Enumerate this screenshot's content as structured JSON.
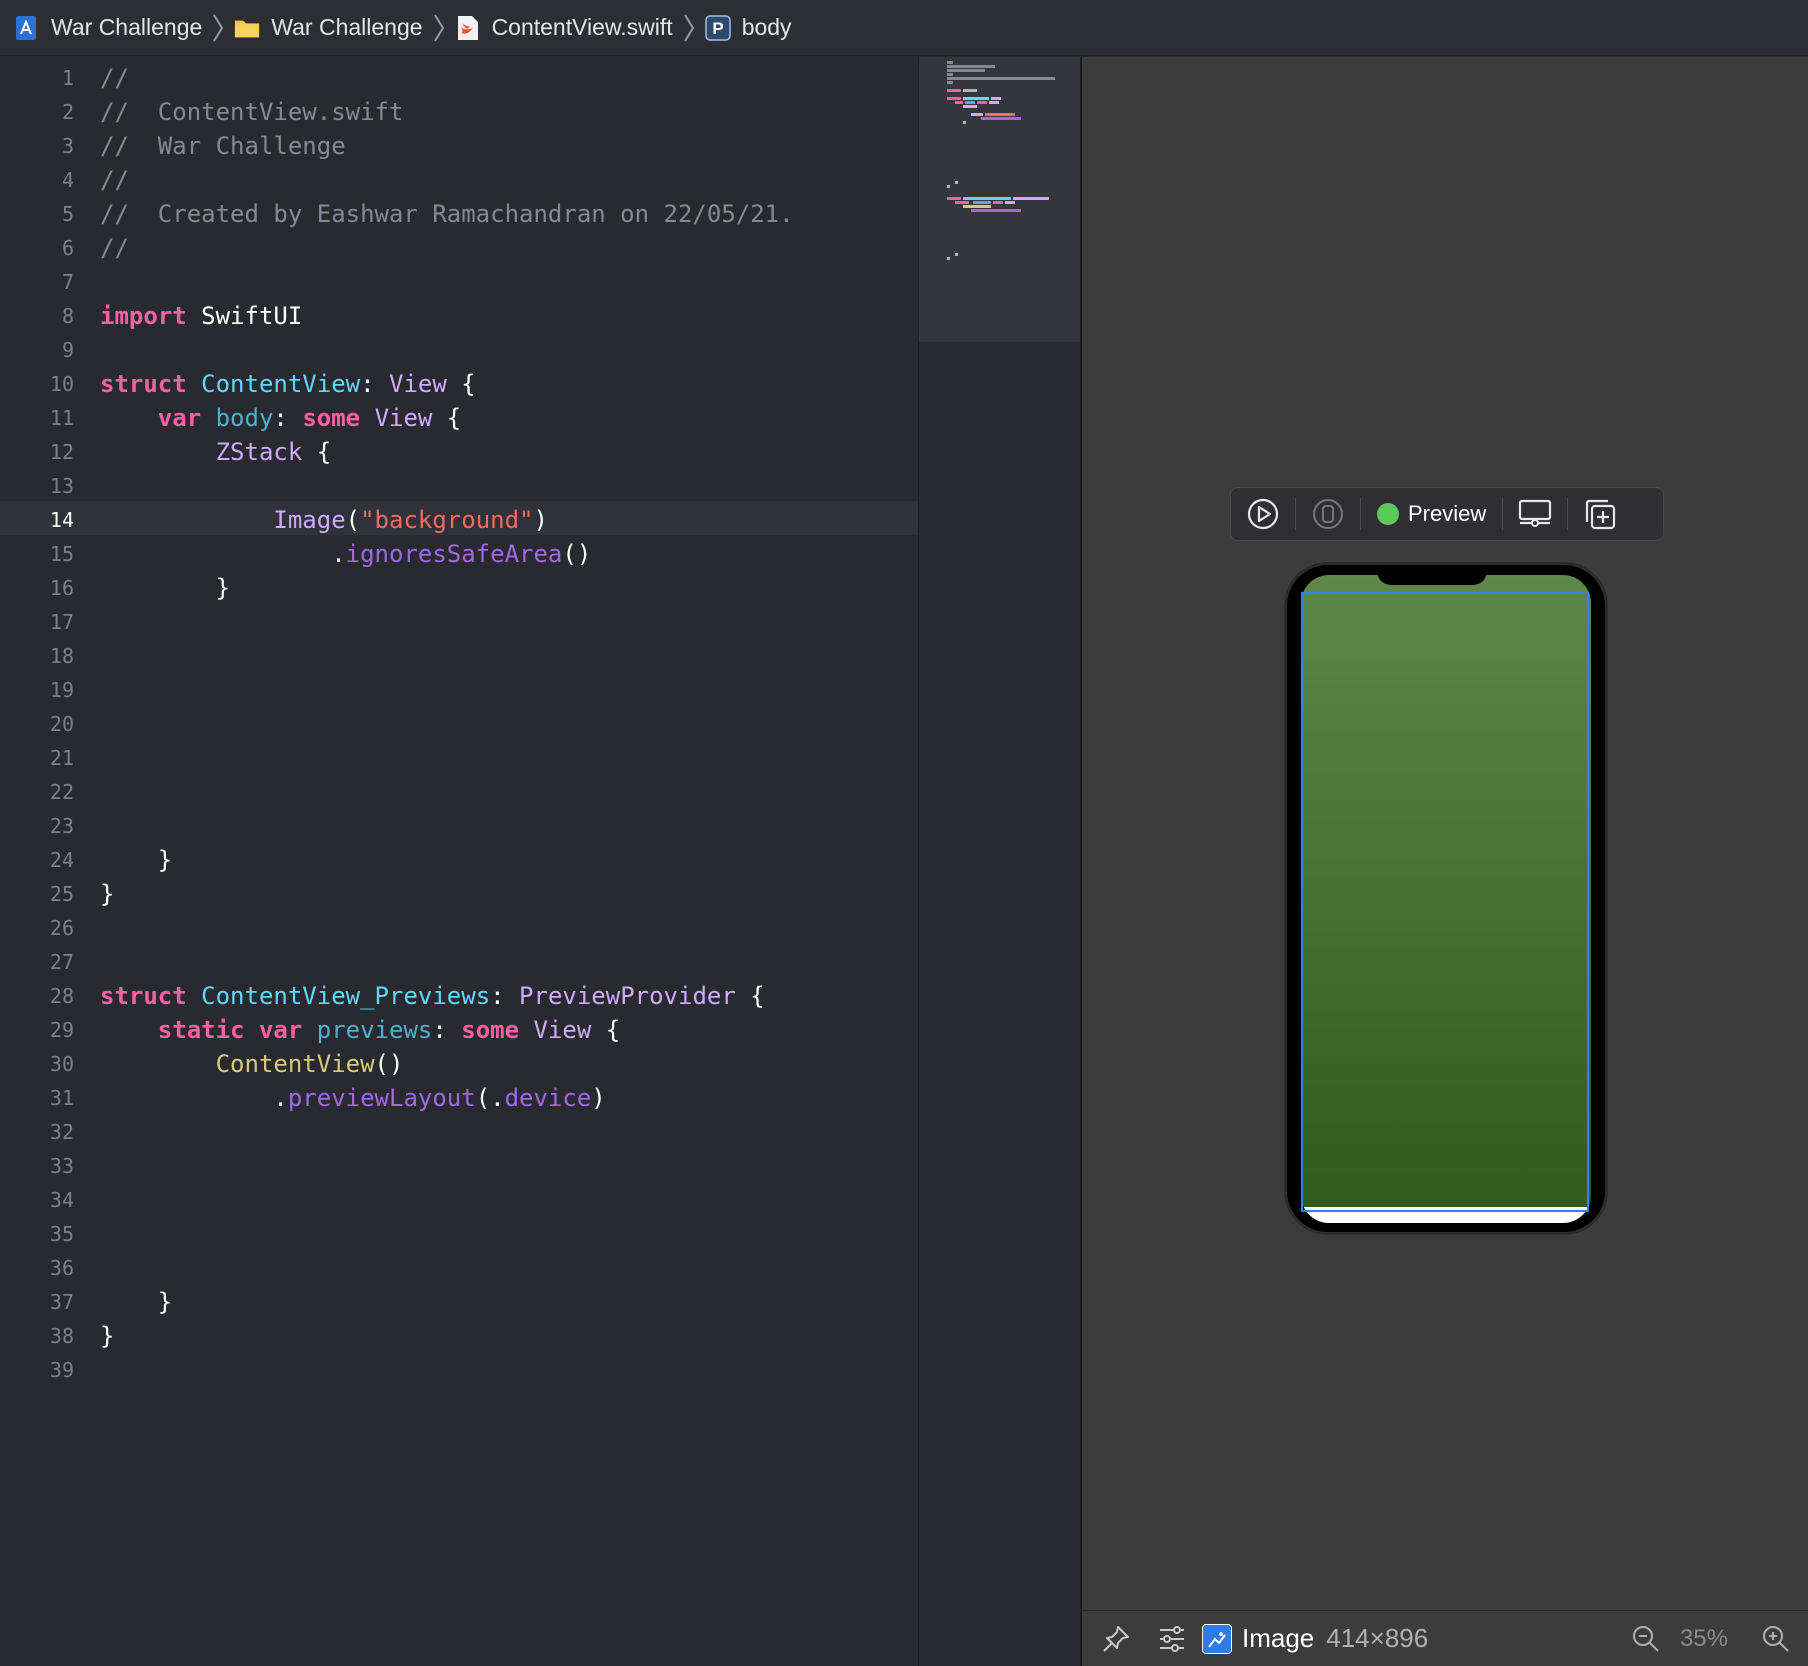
{
  "breadcrumb": [
    {
      "label": "War Challenge",
      "icon": "xcode-project-icon"
    },
    {
      "label": "War Challenge",
      "icon": "folder-icon"
    },
    {
      "label": "ContentView.swift",
      "icon": "swift-file-icon"
    },
    {
      "label": "body",
      "icon": "property-icon",
      "icon_letter": "P"
    }
  ],
  "editor": {
    "current_line": 14,
    "line_numbers": [
      "1",
      "2",
      "3",
      "4",
      "5",
      "6",
      "7",
      "8",
      "9",
      "10",
      "11",
      "12",
      "13",
      "14",
      "15",
      "16",
      "17",
      "18",
      "19",
      "20",
      "21",
      "22",
      "23",
      "24",
      "25",
      "26",
      "27",
      "28",
      "29",
      "30",
      "31",
      "32",
      "33",
      "34",
      "35",
      "36",
      "37",
      "38",
      "39"
    ],
    "lines": [
      [
        {
          "t": "//",
          "c": "com"
        }
      ],
      [
        {
          "t": "//  ContentView.swift",
          "c": "com"
        }
      ],
      [
        {
          "t": "//  War Challenge",
          "c": "com"
        }
      ],
      [
        {
          "t": "//",
          "c": "com"
        }
      ],
      [
        {
          "t": "//  Created by Eashwar Ramachandran on 22/05/21.",
          "c": "com"
        }
      ],
      [
        {
          "t": "//",
          "c": "com"
        }
      ],
      [],
      [
        {
          "t": "import",
          "c": "kw"
        },
        {
          "t": " SwiftUI",
          "c": "plain"
        }
      ],
      [],
      [
        {
          "t": "struct",
          "c": "kw"
        },
        {
          "t": " ",
          "c": "plain"
        },
        {
          "t": "ContentView",
          "c": "decl"
        },
        {
          "t": ": ",
          "c": "plain"
        },
        {
          "t": "View",
          "c": "type"
        },
        {
          "t": " {",
          "c": "plain"
        }
      ],
      [
        {
          "t": "    ",
          "c": "plain"
        },
        {
          "t": "var",
          "c": "kw"
        },
        {
          "t": " ",
          "c": "plain"
        },
        {
          "t": "body",
          "c": "prop"
        },
        {
          "t": ": ",
          "c": "plain"
        },
        {
          "t": "some",
          "c": "kw"
        },
        {
          "t": " ",
          "c": "plain"
        },
        {
          "t": "View",
          "c": "type"
        },
        {
          "t": " {",
          "c": "plain"
        }
      ],
      [
        {
          "t": "        ",
          "c": "plain"
        },
        {
          "t": "ZStack",
          "c": "type"
        },
        {
          "t": " {",
          "c": "plain"
        }
      ],
      [],
      [
        {
          "t": "            ",
          "c": "plain"
        },
        {
          "t": "Image",
          "c": "type"
        },
        {
          "t": "(",
          "c": "plain"
        },
        {
          "t": "\"background\"",
          "c": "str"
        },
        {
          "t": ")",
          "c": "plain"
        }
      ],
      [
        {
          "t": "                .",
          "c": "plain"
        },
        {
          "t": "ignoresSafeArea",
          "c": "method"
        },
        {
          "t": "()",
          "c": "plain"
        }
      ],
      [
        {
          "t": "        }",
          "c": "plain"
        }
      ],
      [],
      [],
      [],
      [],
      [],
      [],
      [],
      [
        {
          "t": "    }",
          "c": "plain"
        }
      ],
      [
        {
          "t": "}",
          "c": "plain"
        }
      ],
      [],
      [],
      [
        {
          "t": "struct",
          "c": "kw"
        },
        {
          "t": " ",
          "c": "plain"
        },
        {
          "t": "ContentView_Previews",
          "c": "decl"
        },
        {
          "t": ": ",
          "c": "plain"
        },
        {
          "t": "PreviewProvider",
          "c": "type"
        },
        {
          "t": " {",
          "c": "plain"
        }
      ],
      [
        {
          "t": "    ",
          "c": "plain"
        },
        {
          "t": "static",
          "c": "kw"
        },
        {
          "t": " ",
          "c": "plain"
        },
        {
          "t": "var",
          "c": "kw"
        },
        {
          "t": " ",
          "c": "plain"
        },
        {
          "t": "previews",
          "c": "prop"
        },
        {
          "t": ": ",
          "c": "plain"
        },
        {
          "t": "some",
          "c": "kw"
        },
        {
          "t": " ",
          "c": "plain"
        },
        {
          "t": "View",
          "c": "type"
        },
        {
          "t": " {",
          "c": "plain"
        }
      ],
      [
        {
          "t": "        ",
          "c": "plain"
        },
        {
          "t": "ContentView",
          "c": "call"
        },
        {
          "t": "()",
          "c": "plain"
        }
      ],
      [
        {
          "t": "            .",
          "c": "plain"
        },
        {
          "t": "previewLayout",
          "c": "method"
        },
        {
          "t": "(.",
          "c": "plain"
        },
        {
          "t": "device",
          "c": "method"
        },
        {
          "t": ")",
          "c": "plain"
        }
      ],
      [],
      [],
      [],
      [],
      [],
      [
        {
          "t": "    }",
          "c": "plain"
        }
      ],
      [
        {
          "t": "}",
          "c": "plain"
        }
      ],
      []
    ]
  },
  "preview": {
    "label": "Preview",
    "status_color": "#5ac85a",
    "toolbar_icons": [
      "live-preview-icon",
      "preview-on-device-icon",
      "device-settings-icon",
      "duplicate-preview-icon"
    ]
  },
  "canvas_bar": {
    "inspected_name": "Image",
    "inspected_size": "414×896",
    "zoom_level": "35%"
  },
  "colors": {
    "keyword": "#fc5fa3",
    "comment": "#7f8c98",
    "string": "#fc6a5d",
    "type": "#d0a8ff",
    "declaration": "#5dd8ff",
    "selection": "#3b7cf5"
  }
}
